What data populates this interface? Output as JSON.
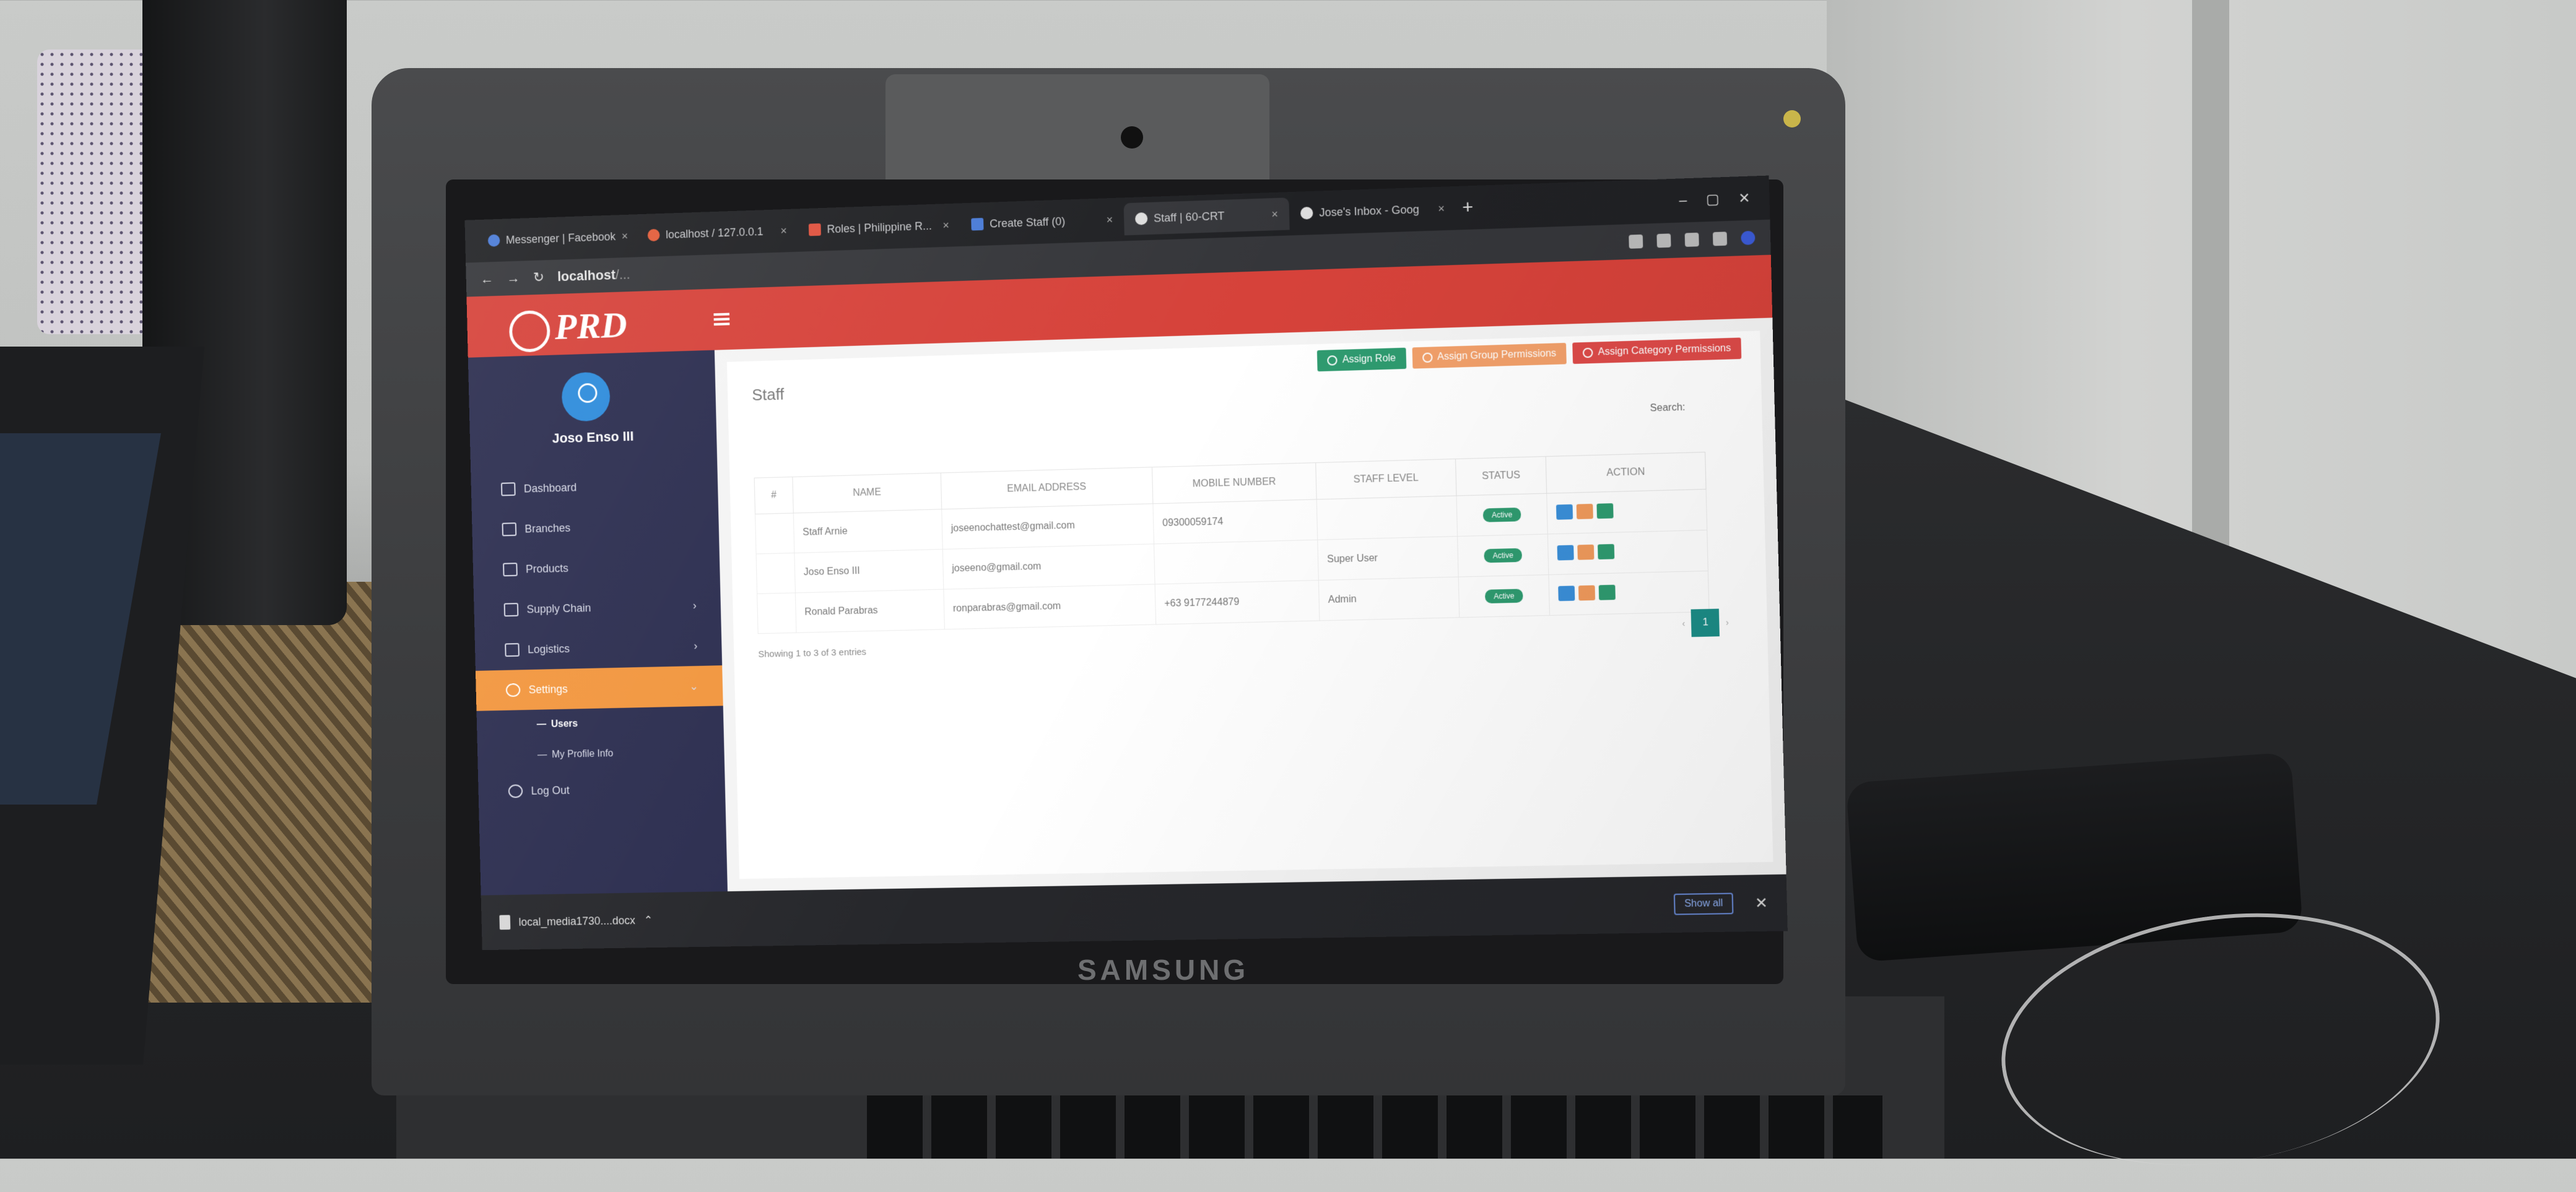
{
  "browser": {
    "tabs": [
      {
        "label": "Messenger | Facebook"
      },
      {
        "label": "localhost / 127.0.0.1"
      },
      {
        "label": "Roles | Philippine R..."
      },
      {
        "label": "Create Staff (0)"
      },
      {
        "label": "Staff | 60-CRT"
      },
      {
        "label": "Jose's Inbox - Goog"
      }
    ],
    "address": {
      "host": "localhost",
      "path": "/..."
    }
  },
  "app": {
    "logo": "PRD",
    "user_name": "Joso Enso III",
    "menu": [
      {
        "label": "Dashboard",
        "icon": "monitor-icon"
      },
      {
        "label": "Branches",
        "icon": "people-icon"
      },
      {
        "label": "Products",
        "icon": "box-icon"
      },
      {
        "label": "Supply Chain",
        "icon": "truck-icon",
        "has_children": true
      },
      {
        "label": "Logistics",
        "icon": "shield-icon",
        "has_children": true
      },
      {
        "label": "Settings",
        "icon": "gear-icon",
        "active": true
      }
    ],
    "submenu": [
      {
        "label": "Users",
        "current": true
      },
      {
        "label": "My Profile Info"
      }
    ],
    "logout": "Log Out"
  },
  "page": {
    "title": "Staff",
    "actions": {
      "assign_role": "Assign Role",
      "assign_group": "Assign Group Permissions",
      "assign_category": "Assign Category Permissions"
    },
    "search_label": "Search:",
    "table": {
      "headers": [
        "#",
        "NAME",
        "EMAIL ADDRESS",
        "MOBILE NUMBER",
        "STAFF LEVEL",
        "STATUS",
        "ACTION"
      ],
      "rows": [
        {
          "num": "",
          "name": "Staff Arnie",
          "email": "joseenochattest@gmail.com",
          "mobile": "09300059174",
          "level": "",
          "status": "Active"
        },
        {
          "num": "",
          "name": "Joso Enso III",
          "email": "joseeno@gmail.com",
          "mobile": "",
          "level": "Super User",
          "status": "Active"
        },
        {
          "num": "",
          "name": "Ronald Parabras",
          "email": "ronparabras@gmail.com",
          "mobile": "+63 9177244879",
          "level": "Admin",
          "status": "Active"
        }
      ]
    },
    "showing": "Showing 1 to 3 of 3 entries",
    "current_page": "1"
  },
  "downloads": {
    "file": "local_media1730....docx",
    "show_all": "Show all"
  },
  "laptop": {
    "brand": "SAMSUNG"
  }
}
